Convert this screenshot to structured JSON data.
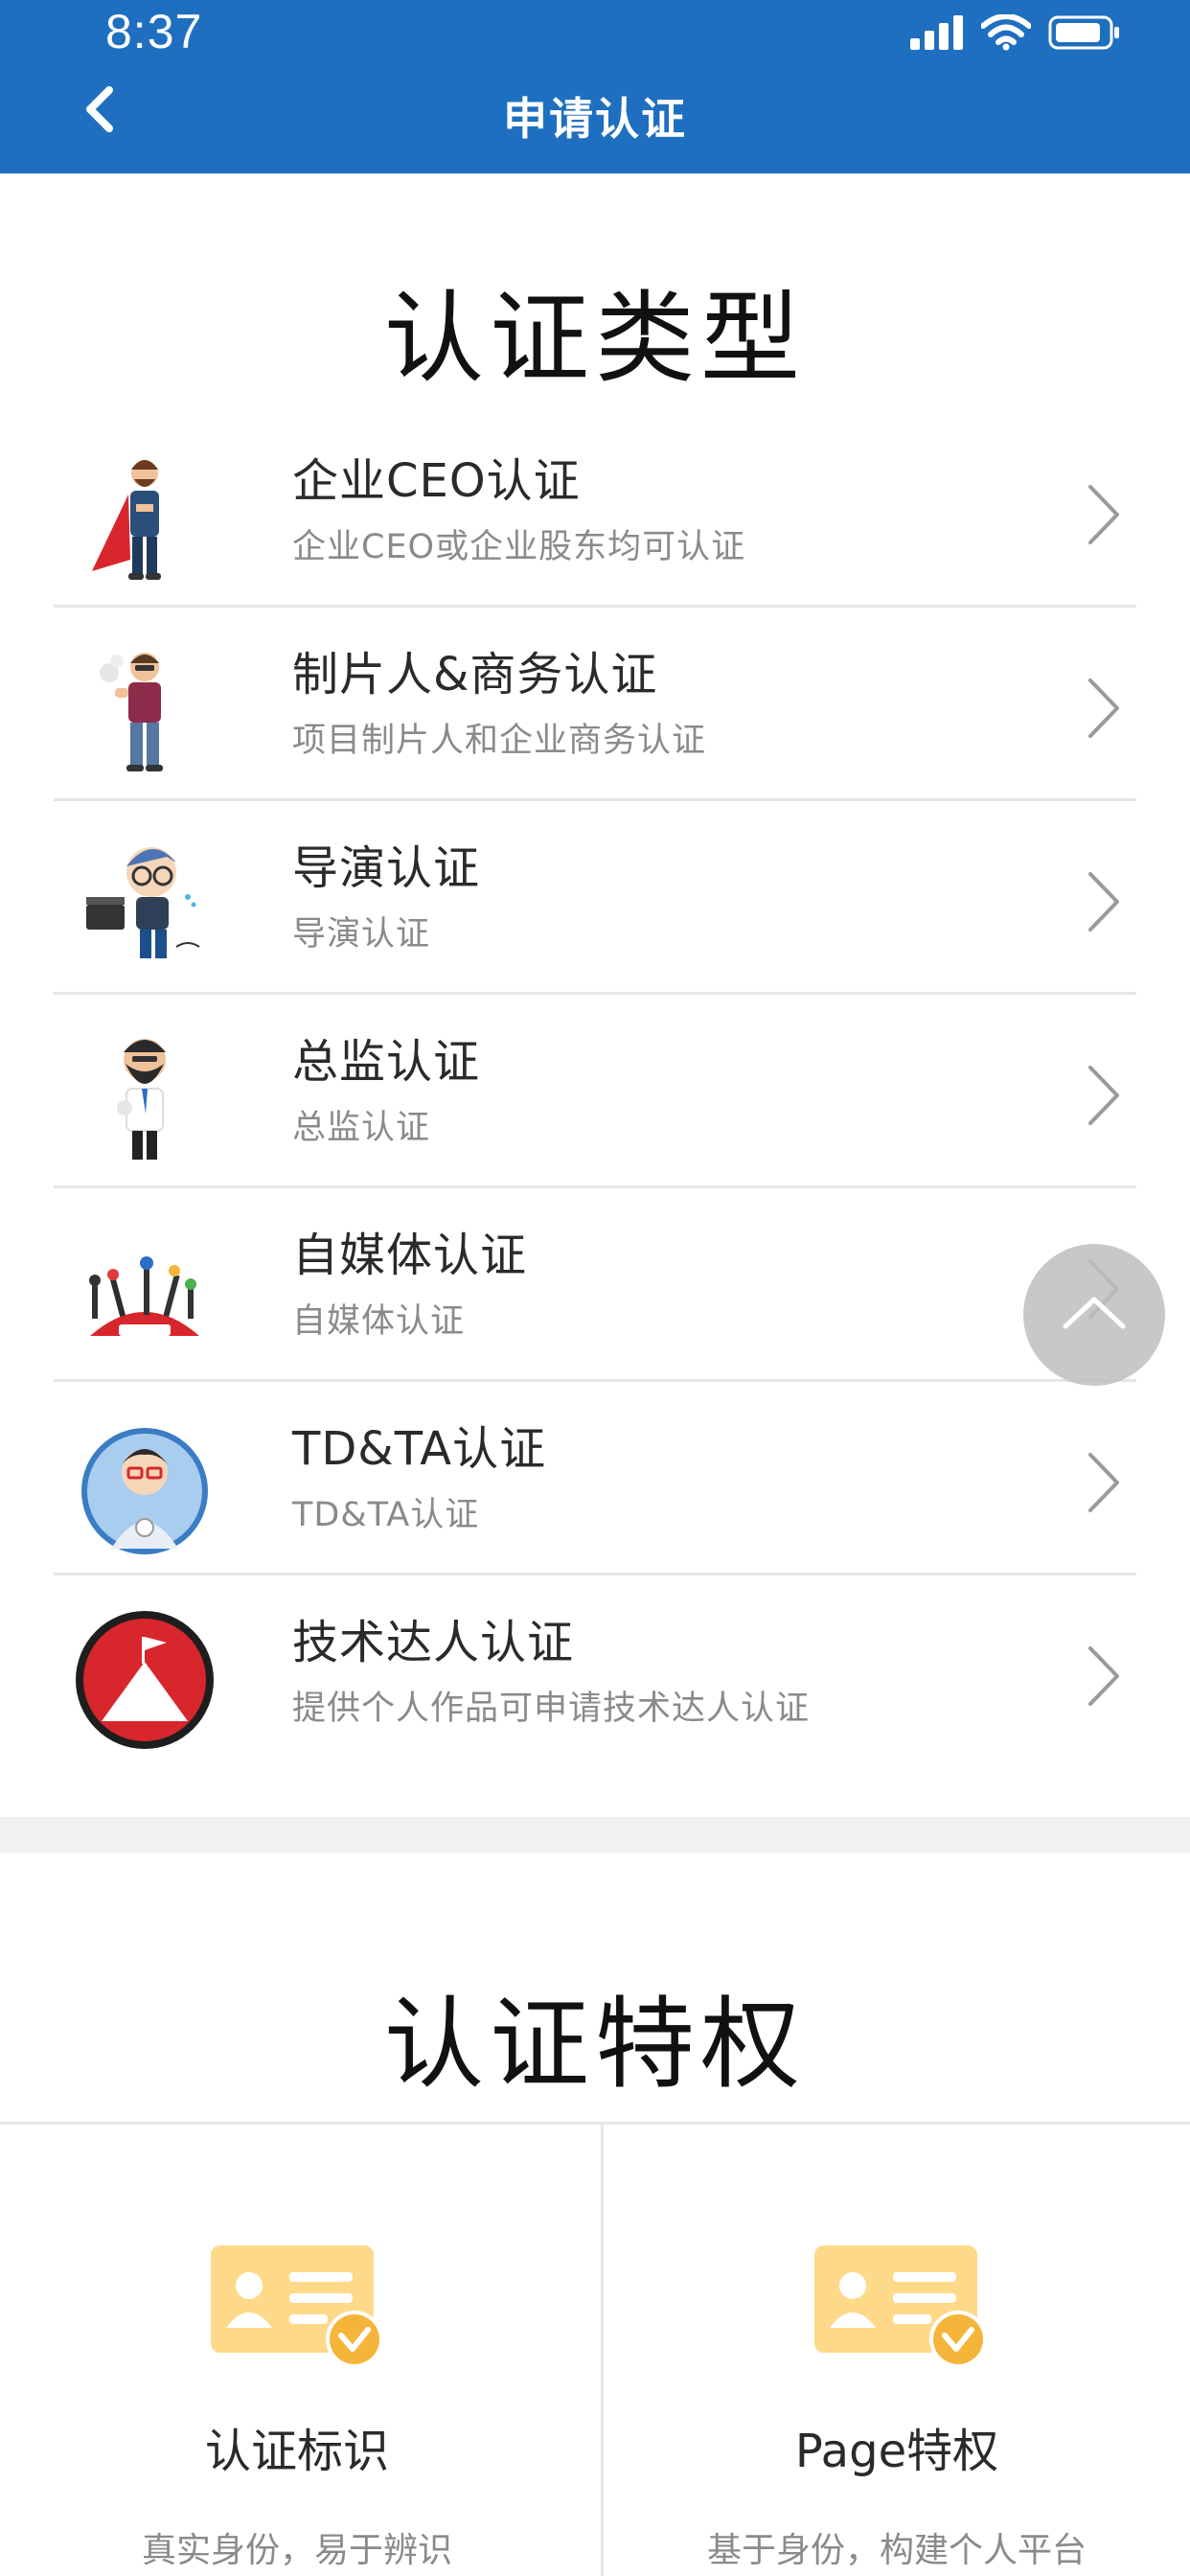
{
  "status_bar": {
    "time": "8:37"
  },
  "nav": {
    "title": "申请认证",
    "back_icon": "chevron-left-icon"
  },
  "section_types": {
    "title": "认证类型",
    "items": [
      {
        "title": "企业CEO认证",
        "subtitle": "企业CEO或企业股东均可认证",
        "avatar": "superhero-ceo-avatar"
      },
      {
        "title": "制片人&商务认证",
        "subtitle": "项目制片人和企业商务认证",
        "avatar": "producer-avatar"
      },
      {
        "title": "导演认证",
        "subtitle": "导演认证",
        "avatar": "director-avatar"
      },
      {
        "title": "总监认证",
        "subtitle": "总监认证",
        "avatar": "bearded-director-avatar"
      },
      {
        "title": "自媒体认证",
        "subtitle": "自媒体认证",
        "avatar": "news-media-avatar"
      },
      {
        "title": "TD&TA认证",
        "subtitle": "TD&TA认证",
        "avatar": "developer-avatar"
      },
      {
        "title": "技术达人认证",
        "subtitle": "提供个人作品可申请技术达人认证",
        "avatar": "mountain-flag-avatar"
      }
    ]
  },
  "section_privileges": {
    "title": "认证特权",
    "items": [
      {
        "title": "认证标识",
        "subtitle": "真实身份，易于辨识",
        "icon": "id-card-check-icon"
      },
      {
        "title": "Page特权",
        "subtitle": "基于身份，构建个人平台",
        "icon": "id-card-check-icon"
      }
    ]
  },
  "colors": {
    "header_bg": "#1f6fc1",
    "card_icon": "#ffd98a",
    "card_check": "#f5b53a"
  }
}
